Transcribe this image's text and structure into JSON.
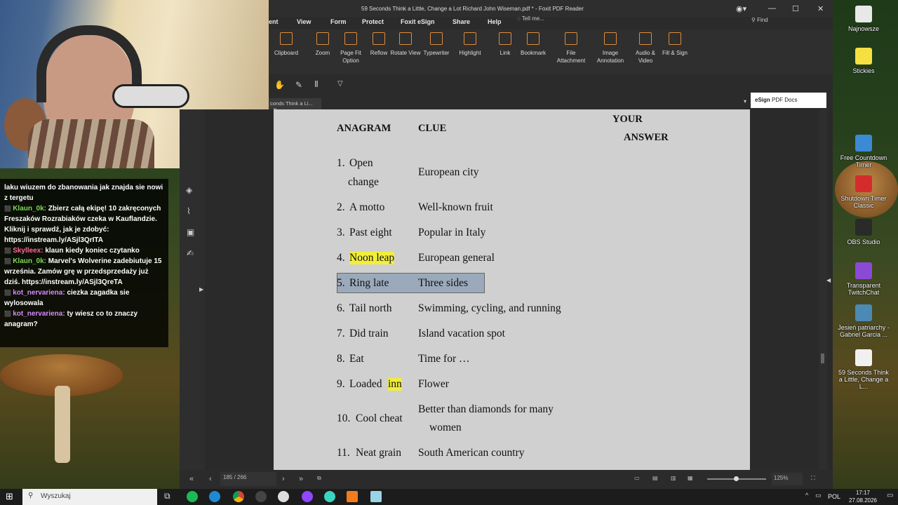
{
  "window": {
    "title": "59 Seconds Think a Little, Change a Lot Richard John Wiseman.pdf * - Foxit PDF Reader",
    "find_placeholder": "Find",
    "tell_me": "Tell me..."
  },
  "menu": [
    "ent",
    "View",
    "Form",
    "Protect",
    "Foxit eSign",
    "Share",
    "Help"
  ],
  "ribbon": [
    {
      "label": "Clipboard",
      "icon": "clipboard-icon"
    },
    {
      "label": "Zoom",
      "icon": "zoom-icon"
    },
    {
      "label": "Page Fit Option",
      "icon": "page-fit-icon"
    },
    {
      "label": "Reflow",
      "icon": "reflow-icon"
    },
    {
      "label": "Rotate View",
      "icon": "rotate-icon"
    },
    {
      "label": "Typewriter",
      "icon": "typewriter-icon"
    },
    {
      "label": "Highlight",
      "icon": "highlight-icon"
    },
    {
      "label": "Link",
      "icon": "link-icon"
    },
    {
      "label": "Bookmark",
      "icon": "bookmark-icon"
    },
    {
      "label": "File Attachment",
      "icon": "file-attachment-icon"
    },
    {
      "label": "Image Annotation",
      "icon": "image-annotation-icon"
    },
    {
      "label": "Audio & Video",
      "icon": "audio-video-icon"
    },
    {
      "label": "Fill & Sign",
      "icon": "fill-sign-icon"
    }
  ],
  "tab": {
    "label": "conds Think a Li..."
  },
  "esign": {
    "label_bold": "eSign",
    "label_rest": "PDF Docs"
  },
  "document": {
    "headers": {
      "anagram": "ANAGRAM",
      "clue": "CLUE",
      "your": "YOUR",
      "answer": "ANSWER"
    },
    "rows": [
      {
        "num": "1.",
        "anagram": "Open",
        "anagram2": "change",
        "clue": "European city"
      },
      {
        "num": "2.",
        "anagram": "A motto",
        "clue": "Well-known fruit"
      },
      {
        "num": "3.",
        "anagram": "Past eight",
        "clue": "Popular in Italy"
      },
      {
        "num": "4.",
        "anagram": "Noon leap",
        "clue": "European general"
      },
      {
        "num": "5.",
        "anagram": "Ring late",
        "clue": "Three sides"
      },
      {
        "num": "6.",
        "anagram": "Tail north",
        "clue": "Swimming, cycling, and running"
      },
      {
        "num": "7.",
        "anagram": "Did train",
        "clue": "Island vacation spot"
      },
      {
        "num": "8.",
        "anagram": "Eat",
        "clue": "Time for …"
      },
      {
        "num": "9.",
        "anagram_pre": "Loaded ",
        "anagram_hl": "inn",
        "clue": "Flower"
      },
      {
        "num": "10.",
        "anagram": "Cool cheat",
        "clue": "Better than diamonds for many",
        "clue2": "women"
      },
      {
        "num": "11.",
        "anagram": "Neat grain",
        "clue": "South American country"
      }
    ]
  },
  "status": {
    "page": "185 / 266",
    "zoom": "125%"
  },
  "chat": [
    {
      "text": "laku wiuzem do zbanowania jak znajda sie nowi z tergetu"
    },
    {
      "user": "Klaun_0k:",
      "text": "Zbierz całą ekipę! 10 zakręconych Freszaków Rozrabiaków czeka w Kauflandzie. Kliknij i sprawdź, jak je zdobyć: https://instream.ly/ASjl3QrITA"
    },
    {
      "user": "Skylleex:",
      "text": "klaun kiedy koniec czytanko"
    },
    {
      "user": "Klaun_0k:",
      "text": "Marvel's Wolverine zadebiutuje 15 września. Zamów grę w przedsprzedaży już dziś. https://instream.ly/ASjl3QreTA"
    },
    {
      "user": "kot_nervariena:",
      "text": "ciezka zagadka sie wylosowala"
    },
    {
      "user": "kot_nervariena:",
      "text": "ty wiesz co to znaczy anagram?"
    }
  ],
  "desktop": [
    {
      "label": "Najnowsze",
      "color": "#e8e8e8"
    },
    {
      "label": "Stickies",
      "color": "#f4e040"
    },
    {
      "label": "Free Countdown Timer",
      "color": "#3a8ad4"
    },
    {
      "label": "Shutdown Timer Classic",
      "color": "#d42c2c"
    },
    {
      "label": "OBS Studio",
      "color": "#2a2a2a"
    },
    {
      "label": "Transparent TwitchChat",
      "color": "#8a4ad4"
    },
    {
      "label": "Jesień patriarchy - Gabriel Garcia ...",
      "color": "#4a8ab4"
    },
    {
      "label": "59 Seconds Think a Little, Change a L...",
      "color": "#f0f0f0"
    }
  ],
  "taskbar": {
    "search": "Wyszukaj",
    "lang": "POL",
    "time": "17:17",
    "date": "27.08.2026"
  }
}
